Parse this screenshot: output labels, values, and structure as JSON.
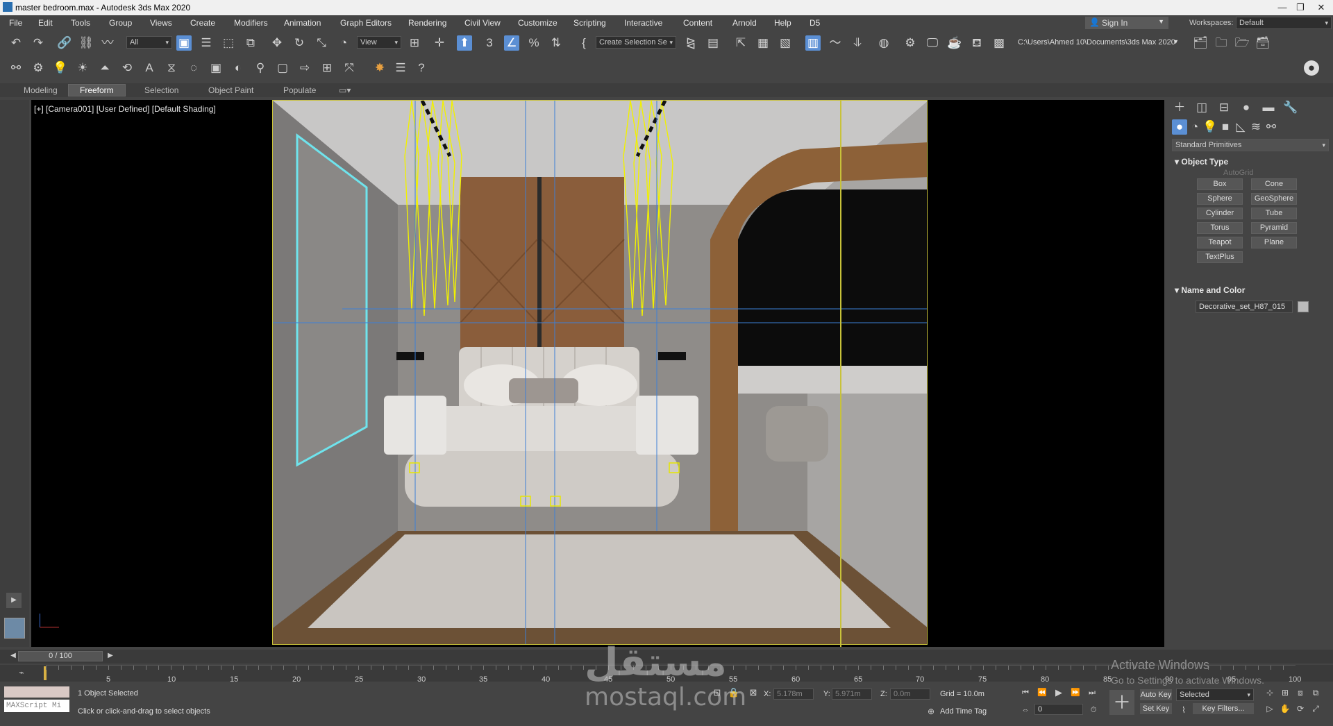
{
  "window": {
    "title": "master bedroom.max - Autodesk 3ds Max 2020",
    "controls": [
      "minimize",
      "maximize",
      "close"
    ]
  },
  "menu": [
    "File",
    "Edit",
    "Tools",
    "Group",
    "Views",
    "Create",
    "Modifiers",
    "Animation",
    "Graph Editors",
    "Rendering",
    "Civil View",
    "Customize",
    "Scripting",
    "Interactive",
    "Content",
    "Arnold",
    "Help",
    "D5"
  ],
  "account": {
    "sign_in": "Sign In",
    "workspaces_label": "Workspaces:",
    "workspace": "Default"
  },
  "toolbar": {
    "selection_filter": "All",
    "ref_coord": "View",
    "named_selection": "Create Selection Se",
    "project_path": "C:\\Users\\Ahmed 10\\Documents\\3ds Max 2020"
  },
  "ribbon_tabs": [
    "Modeling",
    "Freeform",
    "Selection",
    "Object Paint",
    "Populate"
  ],
  "ribbon_active": "Freeform",
  "viewport": {
    "label": "[+] [Camera001] [User Defined] [Default Shading]"
  },
  "command_panel": {
    "category": "Standard Primitives",
    "object_type_header": "Object Type",
    "autogrid": "AutoGrid",
    "buttons": [
      "Box",
      "Cone",
      "Sphere",
      "GeoSphere",
      "Cylinder",
      "Tube",
      "Torus",
      "Pyramid",
      "Teapot",
      "Plane",
      "TextPlus"
    ],
    "name_color_header": "Name and Color",
    "object_name": "Decorative_set_H87_015"
  },
  "timeline": {
    "frame": "0 / 100",
    "ticks": [
      "5",
      "10",
      "15",
      "20",
      "25",
      "30",
      "35",
      "40",
      "45",
      "50",
      "55",
      "60",
      "65",
      "70",
      "75",
      "80",
      "85",
      "90",
      "95",
      "100"
    ]
  },
  "status": {
    "maxscript": "MAXScript Mi",
    "selection": "1 Object Selected",
    "prompt": "Click or click-and-drag to select objects",
    "x_label": "X:",
    "x_value": "5.178m",
    "y_label": "Y:",
    "y_value": "5.971m",
    "z_label": "Z:",
    "z_value": "0.0m",
    "grid": "Grid = 10.0m",
    "add_time_tag": "Add Time Tag",
    "auto_key": "Auto Key",
    "set_key": "Set Key",
    "selected_dd": "Selected",
    "key_filters": "Key Filters...",
    "frame_spinner": "0"
  },
  "watermark": {
    "activate_title": "Activate Windows",
    "activate_sub": "Go to Settings to activate Windows.",
    "logo_ar": "مستقل",
    "logo_en": "mostaql.com"
  }
}
